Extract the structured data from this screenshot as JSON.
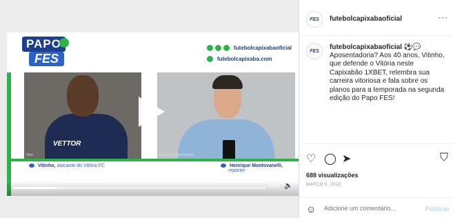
{
  "video": {
    "logo_top": "PAPO",
    "logo_bottom": "FES",
    "social_handle": "futebolcapixabaoficial",
    "website": "futebolcapixaba.com",
    "cam1_label": "Vitor",
    "cam2_label": "Henrique Montovanelli",
    "shirt_text": "VETTOR",
    "guest_name": "Vitinho,",
    "guest_role": "atacante do Vitória FC",
    "host_name": "Henrique Montovanelli,",
    "host_role": "repórter",
    "time": "0:09",
    "progress": 0.17
  },
  "post": {
    "avatar_text": "FES",
    "username": "futebolcapixabaoficial",
    "more_label": "···",
    "caption_user": "futebolcapixabaoficial",
    "caption_emoji": "⚽💬",
    "caption_text": "Aposentadoria? Aos 40 anos, Vitinho, que defende o Vitória neste Capixabão 1XBET, relembra sua carreira vitoriosa e fala sobre os planos para a temporada na segunda edição do Papo FES!",
    "views": "688 visualizações",
    "date": "MARÇO 9, 2022",
    "comment_placeholder": "Adicione um comentário...",
    "publish_label": "Publicar"
  }
}
